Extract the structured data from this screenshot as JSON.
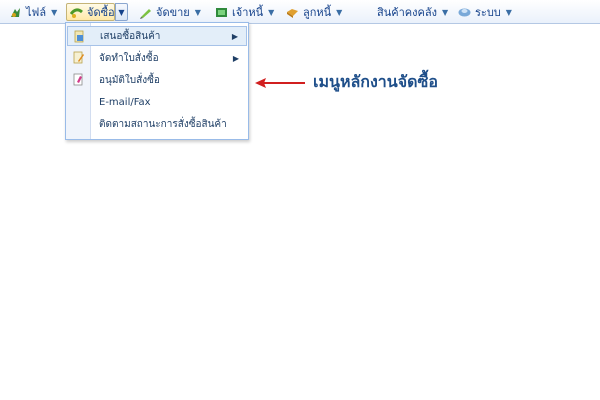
{
  "menubar": {
    "items": [
      {
        "label": "ไฟล์",
        "icon": "file-icon"
      },
      {
        "label": "จัดซื้อ",
        "icon": "purchase-icon"
      },
      {
        "label": "จัดขาย",
        "icon": "sales-icon"
      },
      {
        "label": "เจ้าหนี้",
        "icon": "payable-icon"
      },
      {
        "label": "ลูกหนี้",
        "icon": "receivable-icon"
      },
      {
        "label": "สินค้าคงคลัง",
        "icon": ""
      },
      {
        "label": "ระบบ",
        "icon": "system-icon"
      }
    ]
  },
  "dropdown": {
    "items": [
      {
        "label": "เสนอซื้อสินค้า",
        "has_submenu": true,
        "icon": "quote-request-icon"
      },
      {
        "label": "จัดทำใบสั่งซื้อ",
        "has_submenu": true,
        "icon": "create-po-icon"
      },
      {
        "label": "อนุมัติใบสั่งซื้อ",
        "has_submenu": false,
        "icon": "approve-po-icon"
      },
      {
        "label": "E-mail/Fax",
        "has_submenu": false,
        "icon": ""
      },
      {
        "label": "ติดตามสถานะการสั่งซื้อสินค้า",
        "has_submenu": false,
        "icon": ""
      }
    ]
  },
  "annotation": {
    "text": "เมนูหลักงานจัดซื้อ",
    "arrow_color": "#d11f1f",
    "text_color": "#1f4f8a"
  },
  "colors": {
    "accent": "#15428b",
    "menu_border": "#99bbe8",
    "highlight": "#e3eef9"
  }
}
